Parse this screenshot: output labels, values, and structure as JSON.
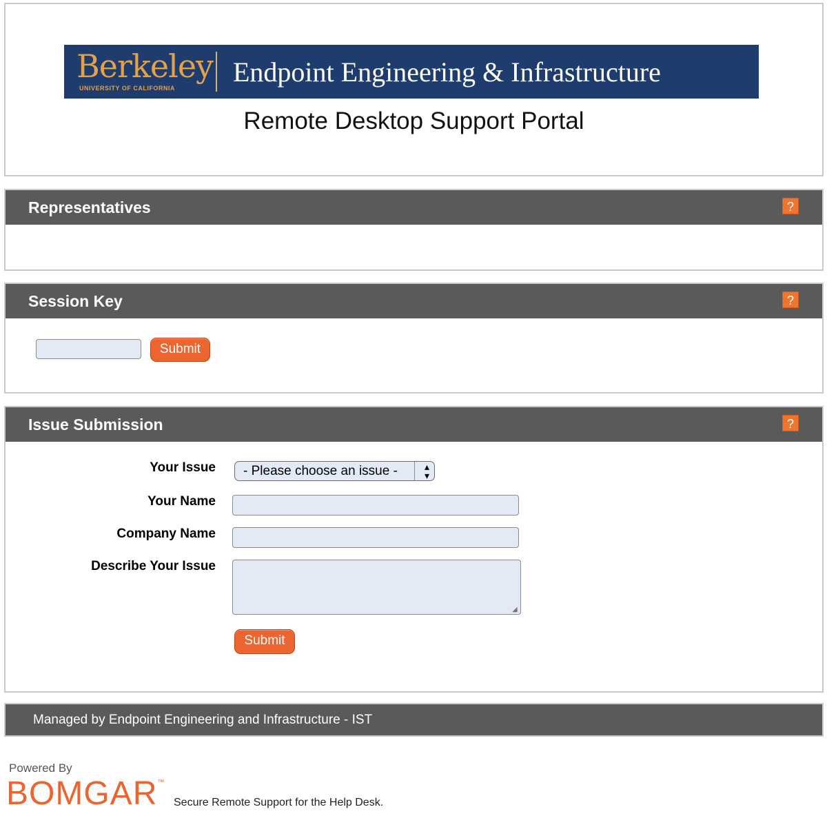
{
  "header": {
    "logo_word": "Berkeley",
    "logo_sub": "UNIVERSITY OF CALIFORNIA",
    "banner_title": "Endpoint Engineering & Infrastructure",
    "portal_title": "Remote Desktop Support Portal"
  },
  "representatives": {
    "title": "Representatives",
    "help_label": "?"
  },
  "session_key": {
    "title": "Session Key",
    "help_label": "?",
    "input_value": "",
    "submit_label": "Submit"
  },
  "issue_submission": {
    "title": "Issue Submission",
    "help_label": "?",
    "issue_label": "Your Issue",
    "issue_selected": "- Please choose an issue -",
    "name_label": "Your Name",
    "name_value": "",
    "company_label": "Company Name",
    "company_value": "",
    "describe_label": "Describe Your Issue",
    "describe_value": "",
    "submit_label": "Submit"
  },
  "footer": {
    "managed_by": "Managed by Endpoint Engineering and Infrastructure - IST"
  },
  "branding": {
    "powered_by": "Powered By",
    "logo_text": "BOMGAR",
    "logo_tm": "™",
    "tagline": "Secure Remote Support for the Help Desk."
  },
  "colors": {
    "banner_navy": "#1f3c6e",
    "berkeley_gold": "#e2a24a",
    "panel_gray": "#5a5a5a",
    "accent_orange": "#ec6430",
    "input_fill": "#e3e9f5"
  }
}
